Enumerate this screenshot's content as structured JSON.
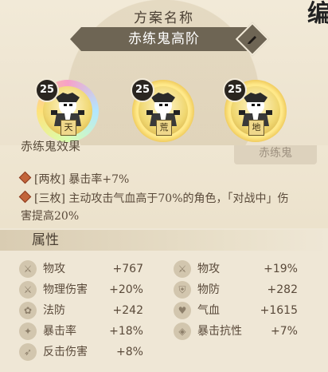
{
  "plan": {
    "title": "方案名称",
    "name": "赤练鬼高阶"
  },
  "corner_text": "编",
  "souls": [
    {
      "level": "25",
      "position": "天",
      "ring": "rainbow"
    },
    {
      "level": "25",
      "position": "荒",
      "ring": "gold"
    },
    {
      "level": "25",
      "position": "地",
      "ring": "gold"
    }
  ],
  "set": {
    "name_partial": "赤练鬼效果",
    "tag": "赤练鬼",
    "effects": [
      "[两枚] 暴击率+7%",
      "[三枚] 主动攻击气血高于70%的角色，「对战中」伤害提高20%"
    ]
  },
  "attributes": {
    "title": "属性",
    "left": [
      {
        "name": "物攻",
        "value": "+767",
        "icon": "sword-icon"
      },
      {
        "name": "物理伤害",
        "value": "+20%",
        "icon": "blade-icon"
      },
      {
        "name": "法防",
        "value": "+242",
        "icon": "magic-defense-icon"
      },
      {
        "name": "暴击率",
        "value": "+18%",
        "icon": "crit-icon"
      },
      {
        "name": "反击伤害",
        "value": "+8%",
        "icon": "counter-icon"
      }
    ],
    "right": [
      {
        "name": "物攻",
        "value": "+19%",
        "icon": "sword-icon"
      },
      {
        "name": "物防",
        "value": "+282",
        "icon": "shield-icon"
      },
      {
        "name": "气血",
        "value": "+1615",
        "icon": "heart-icon"
      },
      {
        "name": "暴击抗性",
        "value": "+7%",
        "icon": "crit-resist-icon"
      }
    ]
  },
  "colors": {
    "banner": "#6e6554",
    "bullet": "#c2643a",
    "text": "#5a4a3a"
  }
}
